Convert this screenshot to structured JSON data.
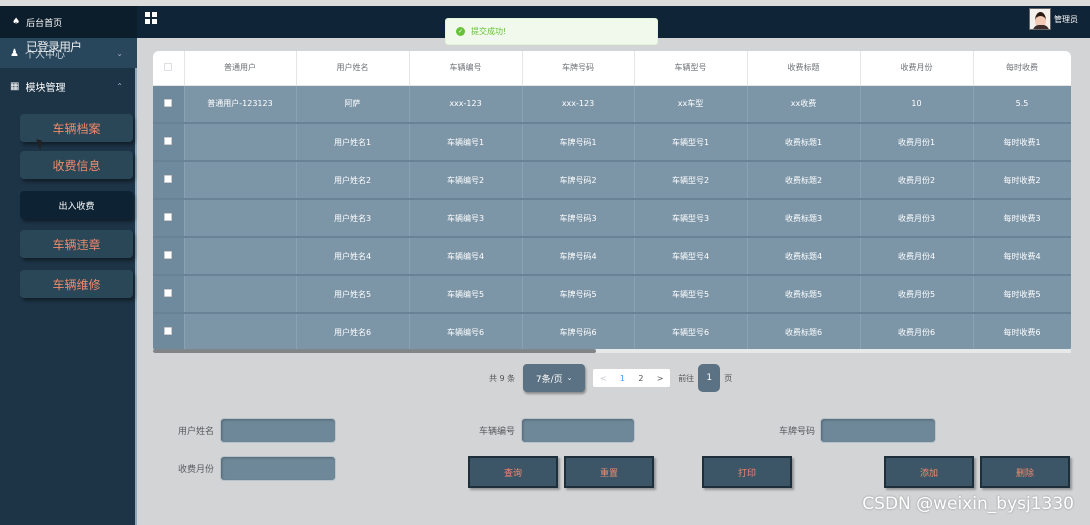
{
  "header": {
    "title_obscured": "",
    "admin_label": "管理员"
  },
  "toast": {
    "message": "提交成功!"
  },
  "sidebar": {
    "home_label": "后台首页",
    "user_group_label": "个人中心",
    "overlay_text": "已登录用户",
    "module_group_label": "模块管理",
    "items": [
      {
        "label": "车辆档案",
        "style": "orange"
      },
      {
        "label": "收费信息",
        "style": "orange"
      },
      {
        "label": "出入收费",
        "style": "white"
      },
      {
        "label": "车辆违章",
        "style": "orange"
      },
      {
        "label": "车辆维修",
        "style": "orange"
      }
    ]
  },
  "table": {
    "headers": [
      "普通用户",
      "用户姓名",
      "车辆编号",
      "车牌号码",
      "车辆型号",
      "收费标题",
      "收费月份",
      "每时收费"
    ],
    "rows": [
      [
        "普通用户-123123",
        "阿萨",
        "xxx-123",
        "xxx-123",
        "xx车型",
        "xx收费",
        "10",
        "5.5"
      ],
      [
        "",
        "用户姓名1",
        "车辆编号1",
        "车牌号码1",
        "车辆型号1",
        "收费标题1",
        "收费月份1",
        "每时收费1"
      ],
      [
        "",
        "用户姓名2",
        "车辆编号2",
        "车牌号码2",
        "车辆型号2",
        "收费标题2",
        "收费月份2",
        "每时收费2"
      ],
      [
        "",
        "用户姓名3",
        "车辆编号3",
        "车牌号码3",
        "车辆型号3",
        "收费标题3",
        "收费月份3",
        "每时收费3"
      ],
      [
        "",
        "用户姓名4",
        "车辆编号4",
        "车牌号码4",
        "车辆型号4",
        "收费标题4",
        "收费月份4",
        "每时收费4"
      ],
      [
        "",
        "用户姓名5",
        "车辆编号5",
        "车牌号码5",
        "车辆型号5",
        "收费标题5",
        "收费月份5",
        "每时收费5"
      ],
      [
        "",
        "用户姓名6",
        "车辆编号6",
        "车牌号码6",
        "车辆型号6",
        "收费标题6",
        "收费月份6",
        "每时收费6"
      ]
    ]
  },
  "pager": {
    "total": "共 9 条",
    "page_size": "7条/页",
    "pages": [
      "1",
      "2"
    ],
    "goto_prefix": "前往",
    "goto_value": "1",
    "goto_suffix": "页"
  },
  "form": {
    "username_label": "用户姓名",
    "vehicle_no_label": "车辆编号",
    "plate_label": "车牌号码",
    "month_label": "收费月份"
  },
  "actions": {
    "query": "查询",
    "reset": "重置",
    "print": "打印",
    "add": "添加",
    "delete": "删除"
  },
  "watermark": "CSDN @weixin_bysj1330",
  "colors": {
    "sidebar_bg": "#1d3447",
    "topbar_bg": "#0f2436",
    "table_row_bg": "#7c96a8",
    "accent_orange": "#f08a6b",
    "toast_green": "#67c23a"
  }
}
